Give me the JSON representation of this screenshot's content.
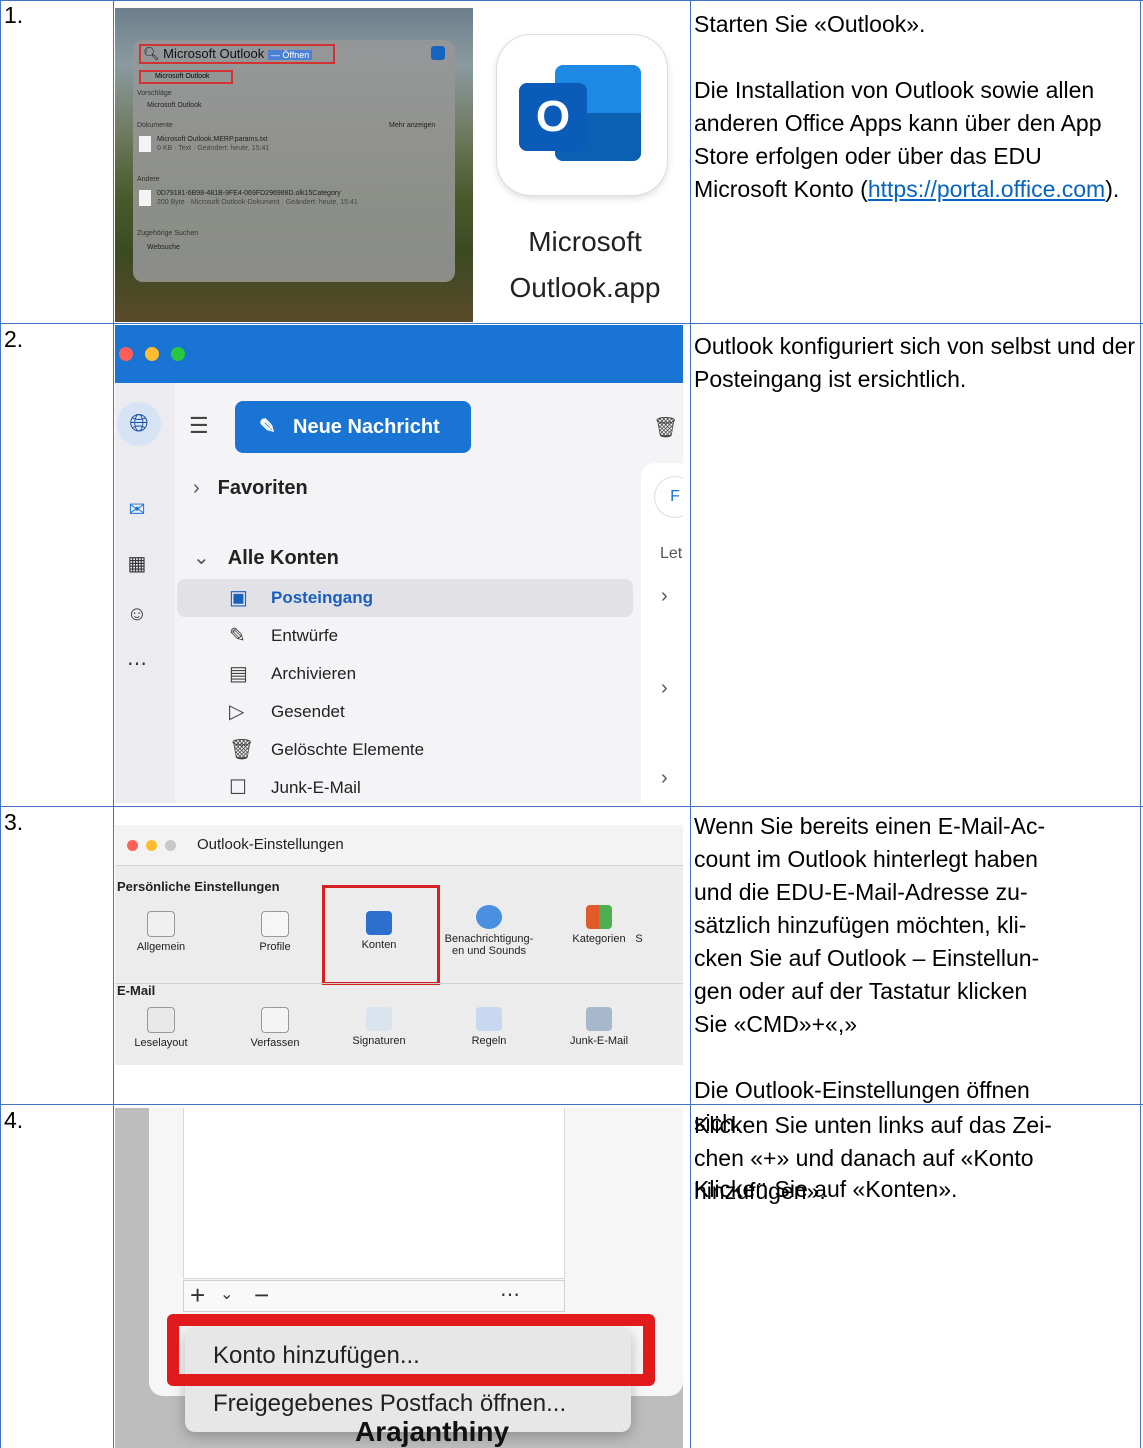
{
  "rows": [
    {
      "number": "1.",
      "description": [
        "Starten Sie «Outlook».",
        "",
        "Die Installation von Outlook sowie allen anderen Office Apps kann über den App Store erfolgen oder über das EDU Microsoft Konto (",
        "https://portal.office.com",
        ")."
      ],
      "spotlight": {
        "query": "Microsoft Outlook",
        "open_hint": "— Öffnen",
        "top_hit": "Microsoft Outlook",
        "sections": [
          "Vorschläge",
          "Dokumente",
          "Andere",
          "Zugehörige Suchen"
        ],
        "suggestion": "Microsoft Outlook",
        "show_more": "Mehr anzeigen",
        "doc_name": "Microsoft Outlook.MERP.params.txt",
        "doc_meta": "0 KB · Text · Geändert: heute, 15:41",
        "other_name": "0D79181-6B98-481B-9FE4-069FD296988D.olk15Category",
        "other_meta": "200 Byte · Microsoft Outlook-Dokument · Geändert: heute, 15:41",
        "web": "Websuche"
      },
      "app_label_1": "Microsoft",
      "app_label_2": "Outlook.app",
      "app_icon_letter": "O"
    },
    {
      "number": "2.",
      "description": "Outlook konfiguriert sich von selbst und der Posteingang ist ersichtlich.",
      "outlook": {
        "new_message": "Neue Nachricht",
        "favorites": "Favoriten",
        "all_accounts": "Alle Konten",
        "folders": [
          "Posteingang",
          "Entwürfe",
          "Archivieren",
          "Gesendet",
          "Gelöschte Elemente",
          "Junk-E-Mail"
        ],
        "right_hint": "Let",
        "badge": "F"
      }
    },
    {
      "number": "3.",
      "description": [
        "Wenn Sie bereits einen E-Mail-Ac-",
        "count im Outlook hinterlegt haben",
        "und die EDU-E-Mail-Adresse zu-",
        "sätzlich hinzufügen möchten, kli-",
        "cken Sie auf Outlook – Einstellun-",
        "gen oder auf der Tastatur klicken",
        "Sie «CMD»+«,»",
        "",
        "Die Outlook-Einstellungen öffnen",
        "sich.",
        "",
        "Klicken Sie auf «Konten»."
      ],
      "settings": {
        "title": "Outlook-Einstellungen",
        "group1": "Persönliche Einstellungen",
        "group1_items": [
          "Allgemein",
          "Profile",
          "Konten",
          "Benachrichtigung-\nen und Sounds",
          "Kategorien",
          "S"
        ],
        "group2": "E-Mail",
        "group2_items": [
          "Leselayout",
          "Verfassen",
          "Signaturen",
          "Regeln",
          "Junk-E-Mail"
        ]
      }
    },
    {
      "number": "4.",
      "description": [
        "Klicken Sie unten links auf das Zei-",
        "chen «+» und danach auf «Konto",
        "hinzufügen»."
      ],
      "menu": {
        "items": [
          "Konto hinzufügen...",
          "Freigegebenes Postfach öffnen..."
        ],
        "name_fragment": "Arajanthiny Puthmakanth"
      }
    }
  ],
  "colors": {
    "border": "#4472c4",
    "link": "#0563c1",
    "outlook_blue": "#1a74d4",
    "highlight_red": "#e11b1b"
  }
}
